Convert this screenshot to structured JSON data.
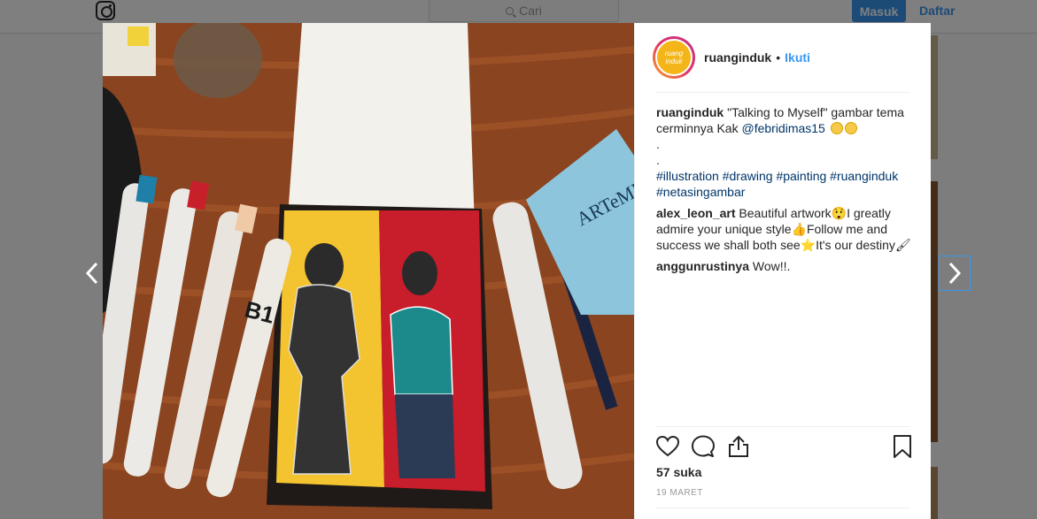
{
  "topbar": {
    "search_placeholder": "Cari",
    "login_label": "Masuk",
    "signup_label": "Daftar"
  },
  "post": {
    "username": "ruanginduk",
    "separator": "•",
    "follow_label": "Ikuti",
    "avatar_text": "ruang induk",
    "caption": {
      "author": "ruanginduk",
      "text": "\"Talking to Myself\" gambar tema cerminnya Kak",
      "mention": "@febridimas15",
      "dot1": ".",
      "dot2": ".",
      "hashtags": [
        "#illustration",
        "#drawing",
        "#painting",
        "#ruanginduk",
        "#netasingambar"
      ]
    },
    "comments": [
      {
        "author": "alex_leon_art",
        "text": "Beautiful artwork😲I greatly admire your unique style👍Follow me and success we shall both see⭐It's our destiny🖌"
      },
      {
        "author": "anggunrustinya",
        "text": "Wow!!."
      }
    ],
    "likes": "57 suka",
    "date": "19 MARET",
    "photo_text": {
      "artemis": "ARTeMIS",
      "marker_label": "B1"
    }
  },
  "colors": {
    "accent": "#3897f0",
    "text": "#262626",
    "hashtag": "#003569",
    "meta": "#999999",
    "left_panel": "#f4c430",
    "right_panel": "#c81d2a"
  },
  "icons": {
    "heart": "heart-icon",
    "comment": "comment-icon",
    "share": "share-icon",
    "bookmark": "bookmark-icon",
    "prev": "chevron-left-icon",
    "next": "chevron-right-icon",
    "instagram": "instagram-logo-icon",
    "search": "search-icon"
  }
}
